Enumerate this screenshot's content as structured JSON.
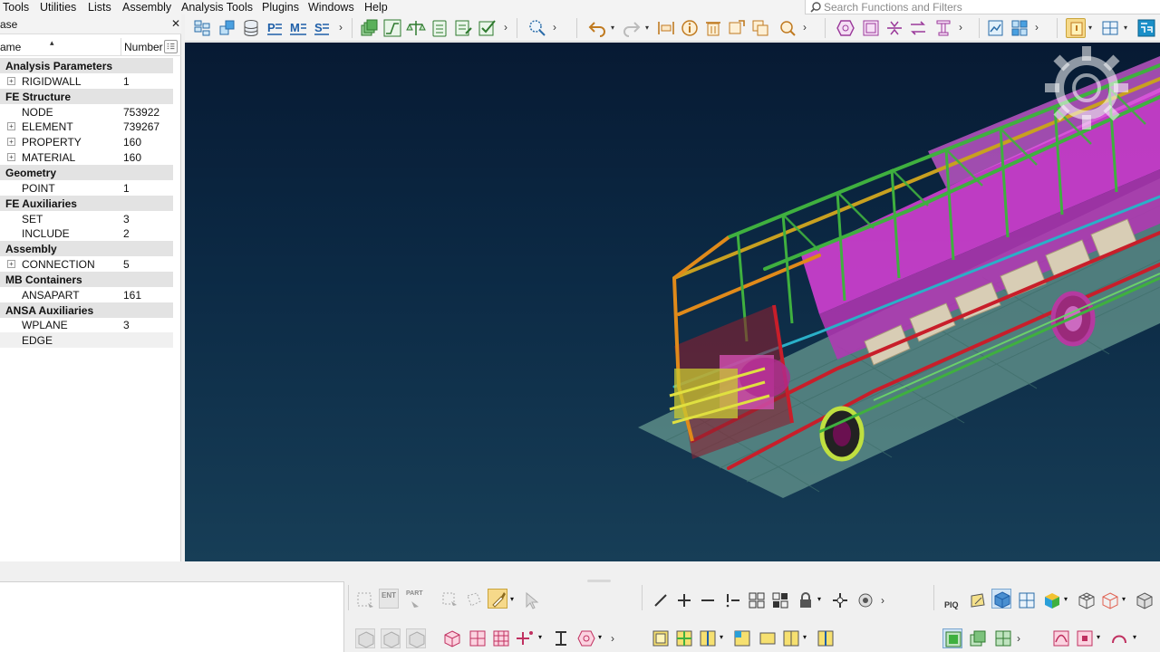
{
  "menu": [
    "Tools",
    "Utilities",
    "Lists",
    "Assembly",
    "Analysis Tools",
    "Plugins",
    "Windows",
    "Help"
  ],
  "search": {
    "placeholder": "Search Functions and Filters"
  },
  "panel": {
    "title": "ase",
    "col_name": "ame",
    "col_number": "Number",
    "rows": [
      {
        "type": "cat",
        "label": "Analysis Parameters"
      },
      {
        "type": "item",
        "label": "RIGIDWALL",
        "value": "1",
        "expand": true
      },
      {
        "type": "cat",
        "label": "FE Structure"
      },
      {
        "type": "item",
        "label": "NODE",
        "value": "753922",
        "expand": false
      },
      {
        "type": "item",
        "label": "ELEMENT",
        "value": "739267",
        "expand": true
      },
      {
        "type": "item",
        "label": "PROPERTY",
        "value": "160",
        "expand": true
      },
      {
        "type": "item",
        "label": "MATERIAL",
        "value": "160",
        "expand": true
      },
      {
        "type": "cat",
        "label": "Geometry"
      },
      {
        "type": "item",
        "label": "POINT",
        "value": "1",
        "expand": false
      },
      {
        "type": "cat",
        "label": "FE Auxiliaries"
      },
      {
        "type": "item",
        "label": "SET",
        "value": "3",
        "expand": false
      },
      {
        "type": "item",
        "label": "INCLUDE",
        "value": "2",
        "expand": false
      },
      {
        "type": "cat",
        "label": "Assembly"
      },
      {
        "type": "item",
        "label": "CONNECTION",
        "value": "5",
        "expand": true
      },
      {
        "type": "cat",
        "label": "MB Containers"
      },
      {
        "type": "item",
        "label": "ANSAPART",
        "value": "161",
        "expand": false
      },
      {
        "type": "cat",
        "label": "ANSA Auxiliaries"
      },
      {
        "type": "item",
        "label": "WPLANE",
        "value": "3",
        "expand": false
      },
      {
        "type": "item",
        "label": "EDGE",
        "value": "",
        "expand": false
      }
    ]
  },
  "bottom_labels": {
    "ent": "ENT",
    "part": "PART",
    "piq": "PIQ"
  },
  "colors": {
    "viewport_top": "#071a33",
    "viewport_bottom": "#173e57",
    "accent_magenta": "#e040e0",
    "frame_green": "#3fb03f"
  },
  "icons": [
    "search-icon",
    "close-icon",
    "sort-caret-icon",
    "column-settings-icon",
    "undo-icon",
    "redo-icon",
    "info-icon",
    "delete-icon",
    "gear-watermark-icon"
  ]
}
